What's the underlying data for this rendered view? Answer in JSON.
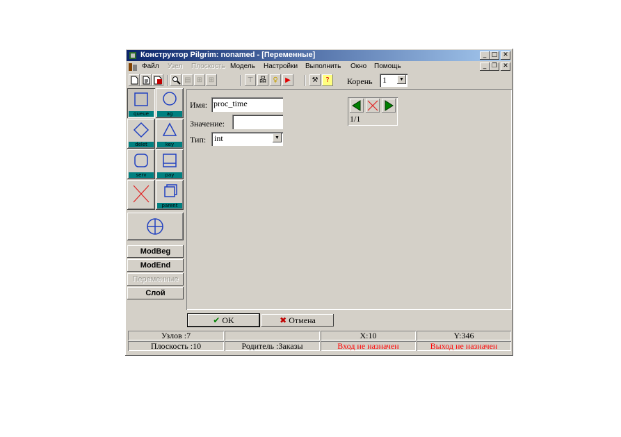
{
  "window": {
    "title": "Конструктор Pilgrim: nonamed - [Переменные]",
    "caption_buttons": [
      "minimize-icon",
      "maximize-icon",
      "close-icon"
    ],
    "mdi_buttons": [
      "minimize-icon",
      "restore-icon",
      "close-icon"
    ]
  },
  "menu": [
    {
      "label": "Файл",
      "enabled": true
    },
    {
      "label": "Узел",
      "enabled": false
    },
    {
      "label": "Плоскость",
      "enabled": false
    },
    {
      "label": "Модель",
      "enabled": true
    },
    {
      "label": "Настройки",
      "enabled": true
    },
    {
      "label": "Выполнить",
      "enabled": true
    },
    {
      "label": "Окно",
      "enabled": true
    },
    {
      "label": "Помощь",
      "enabled": true
    }
  ],
  "toolbar": {
    "icons": [
      "new-file-icon",
      "open-file-icon",
      "save-file-icon",
      "zoom-icon",
      "align-icon",
      "distribute-icon",
      "move-top-icon",
      "tree-icon",
      "bulb-icon",
      "run-icon",
      "build-icon",
      "help-icon"
    ],
    "root_label": "Корень",
    "root_value": "1"
  },
  "palette": {
    "nodes": [
      {
        "caption": "queue",
        "shape": "square"
      },
      {
        "caption": "ag",
        "shape": "circle"
      },
      {
        "caption": "delet",
        "shape": "diamond"
      },
      {
        "caption": "key",
        "shape": "triangle"
      },
      {
        "caption": "serv",
        "shape": "rounded-square"
      },
      {
        "caption": "pay",
        "shape": "tray"
      },
      {
        "caption": "",
        "shape": "cross"
      },
      {
        "caption": "parent",
        "shape": "stacked-squares"
      },
      {
        "caption": "",
        "shape": "crosshair-circle"
      }
    ],
    "buttons": {
      "modbeg": "ModBeg",
      "modend": "ModEnd",
      "variables": "Переменные",
      "layer": "Слой"
    }
  },
  "form": {
    "name_label": "Имя:",
    "name_value": "proc_time",
    "value_label": "Значение:",
    "value_value": "",
    "type_label": "Тип:",
    "type_value": "int",
    "counter": "1/1"
  },
  "dialog": {
    "ok": "OK",
    "cancel": "Отмена"
  },
  "status": {
    "nodes": "Узлов :7",
    "empty": "",
    "x": "X:10",
    "y": "Y:346",
    "plane": "Плоскость :10",
    "parent": "Родитель :Заказы",
    "input": "Вход не назначен",
    "output": "Выход не назначен",
    "warning_color": "#ff0000"
  }
}
